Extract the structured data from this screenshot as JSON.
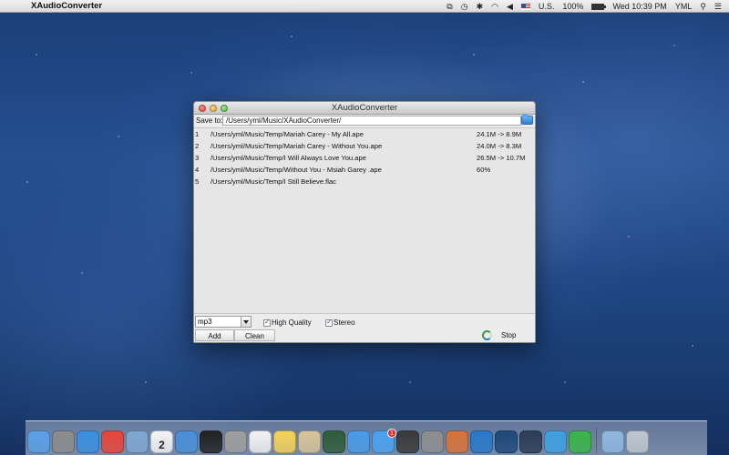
{
  "menubar": {
    "app_name": "XAudioConverter",
    "battery": "100%",
    "input_source": "U.S.",
    "clock": "Wed 10:39 PM",
    "user": "YML",
    "battery_level": 1.0
  },
  "window": {
    "title": "XAudioConverter",
    "save_label": "Save to:",
    "save_path": "/Users/yml/Music/XAudioConverter/",
    "files": [
      {
        "index": "1",
        "path": "/Users/yml/Music/Temp/Mariah Carey - My All.ape",
        "status": "24.1M -> 8.9M"
      },
      {
        "index": "2",
        "path": "/Users/yml/Music/Temp/Mariah Carey - Without You.ape",
        "status": "24.0M -> 8.3M"
      },
      {
        "index": "3",
        "path": "/Users/yml/Music/Temp/I Will Always Love You.ape",
        "status": "26.5M -> 10.7M"
      },
      {
        "index": "4",
        "path": "/Users/yml/Music/Temp/Without You - Msiah Garey .ape",
        "status": "60%"
      },
      {
        "index": "5",
        "path": "/Users/yml/Music/Temp/I Still Believe.flac",
        "status": ""
      }
    ],
    "format": "mp3",
    "high_quality_label": "High Quality",
    "high_quality_checked": true,
    "stereo_label": "Stereo",
    "stereo_checked": true,
    "add_label": "Add",
    "clean_label": "Clean",
    "stop_label": "Stop"
  },
  "dock": {
    "calendar_day": "2",
    "appstore_badge": "1",
    "icons": [
      {
        "name": "finder-icon",
        "color": "#5aa0e6"
      },
      {
        "name": "launchpad-icon",
        "color": "#8c8c8c"
      },
      {
        "name": "safari-icon",
        "color": "#3b8fe0"
      },
      {
        "name": "chrome-icon",
        "color": "#e8453c"
      },
      {
        "name": "preview-icon",
        "color": "#7fa7d1"
      },
      {
        "name": "calendar-icon",
        "color": "#f4f4f4"
      },
      {
        "name": "xcode-icon",
        "color": "#4a8fd8"
      },
      {
        "name": "terminal-icon",
        "color": "#222222"
      },
      {
        "name": "calculator-icon",
        "color": "#9e9e9e"
      },
      {
        "name": "textedit-icon",
        "color": "#f2f2f2"
      },
      {
        "name": "stickies-icon",
        "color": "#f5d35a"
      },
      {
        "name": "preview2-icon",
        "color": "#d8c49a"
      },
      {
        "name": "activity-grid-icon",
        "color": "#2f5d3a"
      },
      {
        "name": "itunes-icon",
        "color": "#4a9be8"
      },
      {
        "name": "app-store-icon",
        "color": "#4aa3f0"
      },
      {
        "name": "activity-monitor-icon",
        "color": "#3a3a3a"
      },
      {
        "name": "system-preferences-icon",
        "color": "#8e8e8e"
      },
      {
        "name": "colorsync-icon",
        "color": "#d9733a"
      },
      {
        "name": "eye-icon",
        "color": "#2a78c8"
      },
      {
        "name": "audio-icon",
        "color": "#1f4a7a"
      },
      {
        "name": "quicktime-icon",
        "color": "#2d3d55"
      },
      {
        "name": "w-app-icon",
        "color": "#3fa0e0"
      },
      {
        "name": "x-app-icon",
        "color": "#3ab54a"
      },
      {
        "name": "downloads-folder-icon",
        "color": "#8fb8e0"
      },
      {
        "name": "trash-icon",
        "color": "#bfc6cf"
      }
    ]
  }
}
